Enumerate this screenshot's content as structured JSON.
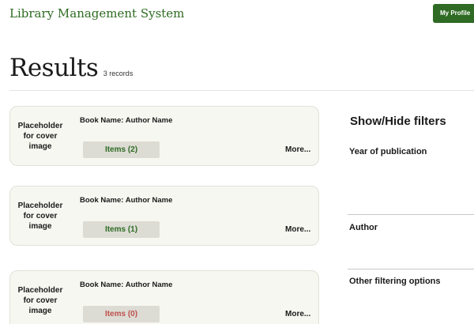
{
  "header": {
    "app_title": "Library Management System",
    "profile_button": "My Profile"
  },
  "results": {
    "title": "Results",
    "count_text": "3 records"
  },
  "books": [
    {
      "cover_placeholder": "Placeholder for cover image",
      "title": "Book Name: Author Name",
      "items_label": "Items (2)",
      "more_label": "More..."
    },
    {
      "cover_placeholder": "Placeholder for cover image",
      "title": "Book Name: Author Name",
      "items_label": "Items (1)",
      "more_label": "More..."
    },
    {
      "cover_placeholder": "Placeholder for cover image",
      "title": "Book Name: Author Name",
      "items_label": "Items (0)",
      "more_label": "More..."
    }
  ],
  "filters": {
    "toggle_label": "Show/Hide filters",
    "year_label": "Year of publication",
    "author_label": "Author",
    "other_label": "Other filtering options"
  },
  "colors": {
    "brand_green": "#2f6b24",
    "card_background": "#f7f7f1",
    "items_button_background": "#dcdcd4",
    "empty_items_red": "#c0504d"
  }
}
